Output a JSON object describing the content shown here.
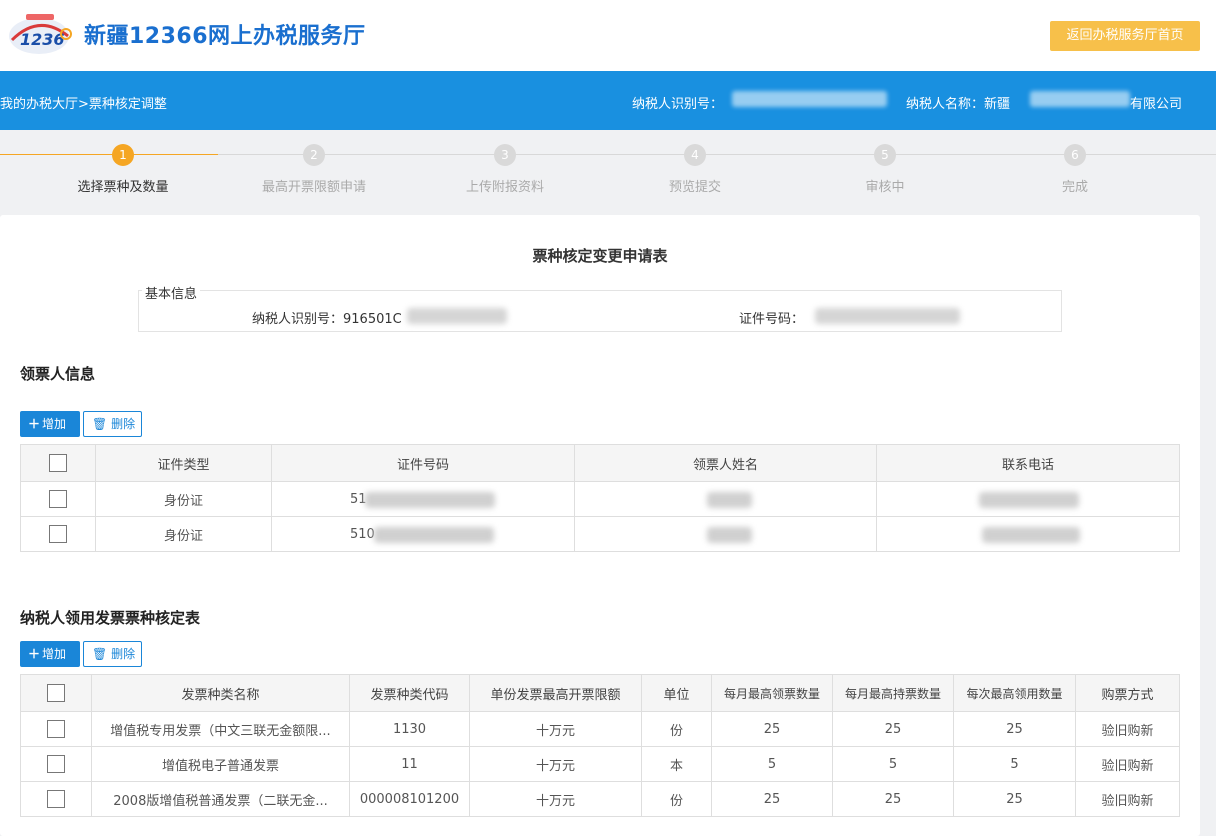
{
  "header": {
    "title": "新疆12366网上办税服务厅",
    "home_button": "返回办税服务厅首页",
    "logo_text": "12366"
  },
  "bluebar": {
    "breadcrumb": "我的办税大厅>票种核定调整",
    "taxpayer_id_label": "纳税人识别号：",
    "taxpayer_name_label": "纳税人名称：新疆",
    "taxpayer_name_suffix": "有限公司"
  },
  "steps": [
    {
      "num": "1",
      "label": "选择票种及数量"
    },
    {
      "num": "2",
      "label": "最高开票限额申请"
    },
    {
      "num": "3",
      "label": "上传附报资料"
    },
    {
      "num": "4",
      "label": "预览提交"
    },
    {
      "num": "5",
      "label": "审核中"
    },
    {
      "num": "6",
      "label": "完成"
    }
  ],
  "form": {
    "title": "票种核定变更申请表",
    "basic_info_legend": "基本信息",
    "taxpayer_id": "纳税人识别号：916501C",
    "cert_no": "证件号码：",
    "add_label": "增加",
    "delete_label": "删除"
  },
  "recipients": {
    "section_title": "领票人信息",
    "headers": [
      "证件类型",
      "证件号码",
      "领票人姓名",
      "联系电话"
    ],
    "rows": [
      {
        "type": "身份证",
        "id_prefix": "51"
      },
      {
        "type": "身份证",
        "id_prefix": "510"
      }
    ]
  },
  "invoices": {
    "section_title": "纳税人领用发票票种核定表",
    "headers": [
      "发票种类名称",
      "发票种类代码",
      "单份发票最高开票限额",
      "单位",
      "每月最高领票数量",
      "每月最高持票数量",
      "每次最高领用数量",
      "购票方式"
    ],
    "rows": [
      {
        "name": "增值税专用发票（中文三联无金额限...",
        "code": "1130",
        "limit": "十万元",
        "unit": "份",
        "monthly_receive": "25",
        "monthly_hold": "25",
        "per_time": "25",
        "method": "验旧购新"
      },
      {
        "name": "增值税电子普通发票",
        "code": "11",
        "limit": "十万元",
        "unit": "本",
        "monthly_receive": "5",
        "monthly_hold": "5",
        "per_time": "5",
        "method": "验旧购新"
      },
      {
        "name": "2008版增值税普通发票（二联无金...",
        "code": "000008101200",
        "limit": "十万元",
        "unit": "份",
        "monthly_receive": "25",
        "monthly_hold": "25",
        "per_time": "25",
        "method": "验旧购新"
      }
    ]
  },
  "colors": {
    "primary_blue": "#1990e0",
    "accent_orange": "#f5a623",
    "home_button": "#f7c04a",
    "title_blue": "#1a6fcf"
  }
}
